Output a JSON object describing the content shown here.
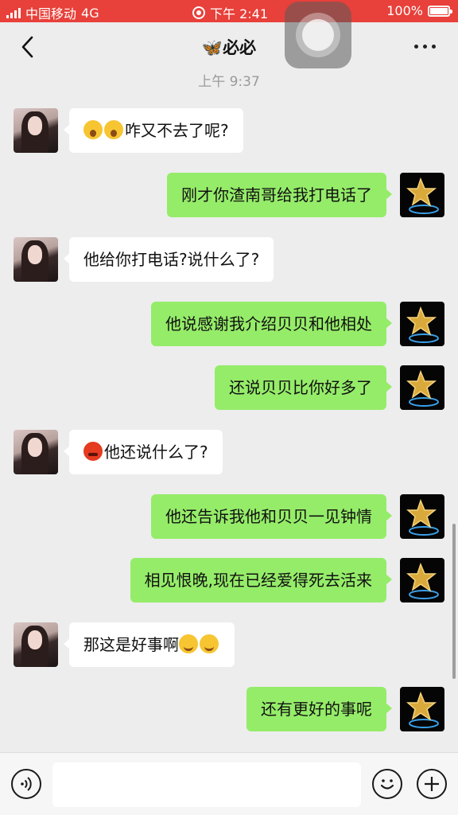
{
  "status_bar": {
    "carrier": "中国移动",
    "network": "4G",
    "time": "下午 2:41",
    "battery": "100%"
  },
  "header": {
    "title": "🦋必必"
  },
  "chat": {
    "timestamp": "上午 9:37",
    "messages": [
      {
        "sender": "other",
        "text": "咋又不去了呢?",
        "emoji": "surprise"
      },
      {
        "sender": "me",
        "text": "刚才你渣南哥给我打电话了"
      },
      {
        "sender": "other",
        "text": "他给你打电话?说什么了?"
      },
      {
        "sender": "me",
        "text": "他说感谢我介绍贝贝和他相处"
      },
      {
        "sender": "me",
        "text": "还说贝贝比你好多了"
      },
      {
        "sender": "other",
        "text": "他还说什么了?",
        "emoji": "angry"
      },
      {
        "sender": "me",
        "text": "他还告诉我他和贝贝一见钟情"
      },
      {
        "sender": "me",
        "text": "相见恨晚,现在已经爱得死去活来"
      },
      {
        "sender": "other",
        "text": "那这是好事啊",
        "emoji": "hug"
      },
      {
        "sender": "me",
        "text": "还有更好的事呢"
      }
    ]
  },
  "input": {
    "value": "",
    "placeholder": ""
  },
  "colors": {
    "status_bar": "#e8403a",
    "outgoing_bubble": "#95ec69",
    "incoming_bubble": "#ffffff",
    "background": "#ededed"
  }
}
